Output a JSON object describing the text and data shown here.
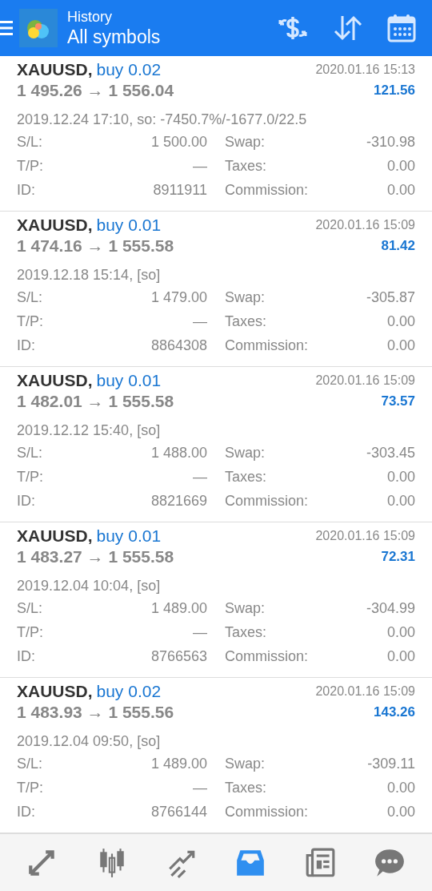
{
  "header": {
    "title": "History",
    "subtitle": "All symbols"
  },
  "deals": [
    {
      "symbol": "XAUUSD,",
      "side": "buy 0.02",
      "close_time": "2020.01.16 15:13",
      "prices": "1 495.26 → 1 556.04",
      "profit": "121.56",
      "open_info": "2019.12.24 17:10, so: -7450.7%/-1677.0/22.5",
      "details": [
        {
          "label": "S/L:",
          "value": "1 500.00"
        },
        {
          "label": "Swap:",
          "value": "-310.98"
        },
        {
          "label": "T/P:",
          "value": "—"
        },
        {
          "label": "Taxes:",
          "value": "0.00"
        },
        {
          "label": "ID:",
          "value": "8911911"
        },
        {
          "label": "Commission:",
          "value": "0.00"
        }
      ]
    },
    {
      "symbol": "XAUUSD,",
      "side": "buy 0.01",
      "close_time": "2020.01.16 15:09",
      "prices": "1 474.16 → 1 555.58",
      "profit": "81.42",
      "open_info": "2019.12.18 15:14, [so]",
      "details": [
        {
          "label": "S/L:",
          "value": "1 479.00"
        },
        {
          "label": "Swap:",
          "value": "-305.87"
        },
        {
          "label": "T/P:",
          "value": "—"
        },
        {
          "label": "Taxes:",
          "value": "0.00"
        },
        {
          "label": "ID:",
          "value": "8864308"
        },
        {
          "label": "Commission:",
          "value": "0.00"
        }
      ]
    },
    {
      "symbol": "XAUUSD,",
      "side": "buy 0.01",
      "close_time": "2020.01.16 15:09",
      "prices": "1 482.01 → 1 555.58",
      "profit": "73.57",
      "open_info": "2019.12.12 15:40, [so]",
      "details": [
        {
          "label": "S/L:",
          "value": "1 488.00"
        },
        {
          "label": "Swap:",
          "value": "-303.45"
        },
        {
          "label": "T/P:",
          "value": "—"
        },
        {
          "label": "Taxes:",
          "value": "0.00"
        },
        {
          "label": "ID:",
          "value": "8821669"
        },
        {
          "label": "Commission:",
          "value": "0.00"
        }
      ]
    },
    {
      "symbol": "XAUUSD,",
      "side": "buy 0.01",
      "close_time": "2020.01.16 15:09",
      "prices": "1 483.27 → 1 555.58",
      "profit": "72.31",
      "open_info": "2019.12.04 10:04, [so]",
      "details": [
        {
          "label": "S/L:",
          "value": "1 489.00"
        },
        {
          "label": "Swap:",
          "value": "-304.99"
        },
        {
          "label": "T/P:",
          "value": "—"
        },
        {
          "label": "Taxes:",
          "value": "0.00"
        },
        {
          "label": "ID:",
          "value": "8766563"
        },
        {
          "label": "Commission:",
          "value": "0.00"
        }
      ]
    },
    {
      "symbol": "XAUUSD,",
      "side": "buy 0.02",
      "close_time": "2020.01.16 15:09",
      "prices": "1 483.93 → 1 555.56",
      "profit": "143.26",
      "open_info": "2019.12.04 09:50, [so]",
      "details": [
        {
          "label": "S/L:",
          "value": "1 489.00"
        },
        {
          "label": "Swap:",
          "value": "-309.11"
        },
        {
          "label": "T/P:",
          "value": "—"
        },
        {
          "label": "Taxes:",
          "value": "0.00"
        },
        {
          "label": "ID:",
          "value": "8766144"
        },
        {
          "label": "Commission:",
          "value": "0.00"
        }
      ]
    }
  ],
  "nav": [
    {
      "kind": "quotes",
      "selected": false
    },
    {
      "kind": "chart",
      "selected": false
    },
    {
      "kind": "trade",
      "selected": false
    },
    {
      "kind": "history",
      "selected": true
    },
    {
      "kind": "news",
      "selected": false
    },
    {
      "kind": "chat",
      "selected": false
    }
  ]
}
